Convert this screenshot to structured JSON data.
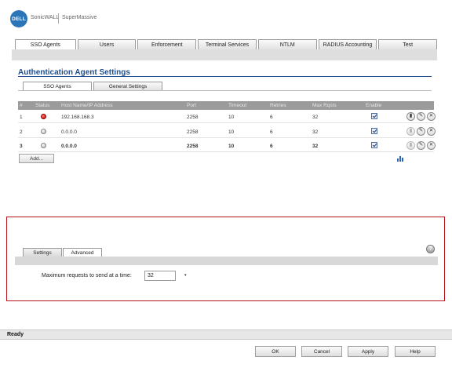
{
  "header": {
    "logo_text": "DELL",
    "brand_primary": "SonicWALL",
    "brand_secondary": "SuperMassive"
  },
  "top_tabs": [
    {
      "label": "SSO Agents",
      "active": true
    },
    {
      "label": "Users",
      "active": false
    },
    {
      "label": "Enforcement",
      "active": false
    },
    {
      "label": "Terminal Services",
      "active": false
    },
    {
      "label": "NTLM",
      "active": false
    },
    {
      "label": "RADIUS Accounting",
      "active": false
    },
    {
      "label": "Test",
      "active": false
    }
  ],
  "section": {
    "title": "Authentication Agent Settings",
    "sub_tabs": [
      {
        "label": "SSO Agents",
        "active": true
      },
      {
        "label": "General Settings",
        "active": false
      }
    ]
  },
  "agents_table": {
    "headers": [
      "#",
      "Status",
      "Host Name/IP Address",
      "Port",
      "Timeout",
      "Retries",
      "Max Rqsts",
      "Enable"
    ],
    "rows": [
      {
        "index": "1",
        "status": "red",
        "host": "192.168.168.3",
        "port": "2258",
        "timeout": "10",
        "retries": "6",
        "max_rqsts": "32",
        "enabled": true
      },
      {
        "index": "2",
        "status": "gray",
        "host": "0.0.0.0",
        "port": "2258",
        "timeout": "10",
        "retries": "6",
        "max_rqsts": "32",
        "enabled": true
      },
      {
        "index": "3",
        "status": "gray",
        "host": "0.0.0.0",
        "port": "2258",
        "timeout": "10",
        "retries": "6",
        "max_rqsts": "32",
        "enabled": true
      }
    ],
    "add_label": "Add..."
  },
  "edit_panel": {
    "tabs": [
      {
        "label": "Settings",
        "active": false
      },
      {
        "label": "Advanced",
        "active": true
      }
    ],
    "help_label": "?",
    "field_label": "Maximum requests to send at a time:",
    "field_value": "32"
  },
  "status_bar": {
    "text": "Ready"
  },
  "buttons": {
    "ok": "OK",
    "cancel": "Cancel",
    "apply": "Apply",
    "help": "Help"
  },
  "colors": {
    "title_blue": "#1f4f8f",
    "panel_border_red": "#b5121b",
    "status_red": "#c00000",
    "status_gray": "#a8a8a8"
  }
}
